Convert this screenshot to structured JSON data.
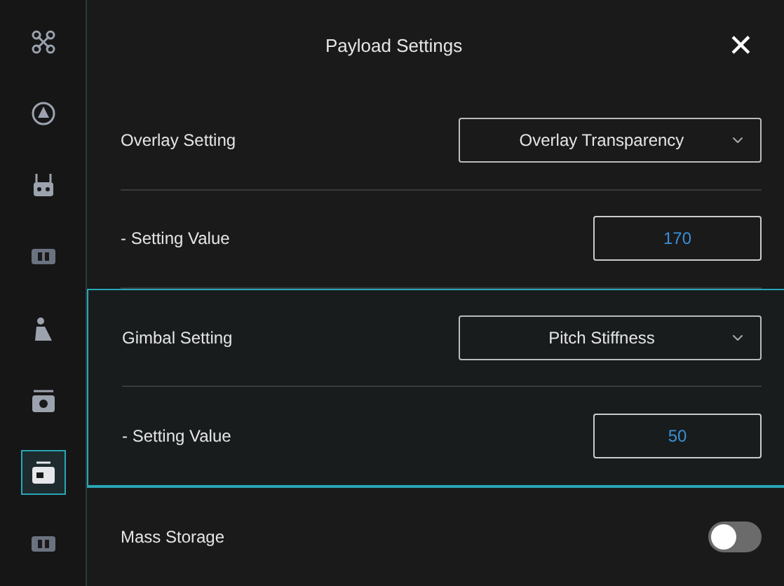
{
  "sidebar": {
    "items": [
      {
        "kind": "drone",
        "selected": false
      },
      {
        "kind": "compass",
        "selected": false
      },
      {
        "kind": "controller",
        "selected": false
      },
      {
        "kind": "hd",
        "selected": false
      },
      {
        "kind": "person",
        "selected": false
      },
      {
        "kind": "camera",
        "selected": false
      },
      {
        "kind": "payload",
        "selected": true
      },
      {
        "kind": "hd",
        "selected": false
      }
    ]
  },
  "header": {
    "title": "Payload Settings",
    "close": "✕"
  },
  "rows": [
    {
      "kind": "select",
      "label": "Overlay Setting",
      "value": "Overlay Transparency",
      "highlighted": false
    },
    {
      "kind": "number",
      "label": "- Setting Value",
      "value": "170",
      "highlighted": false
    },
    {
      "kind": "select",
      "label": "Gimbal Setting",
      "value": "Pitch Stiffness",
      "highlighted": true
    },
    {
      "kind": "number",
      "label": "- Setting Value",
      "value": "50",
      "highlighted": true
    },
    {
      "kind": "toggle",
      "label": "Mass Storage",
      "on": false,
      "highlighted": false
    }
  ]
}
